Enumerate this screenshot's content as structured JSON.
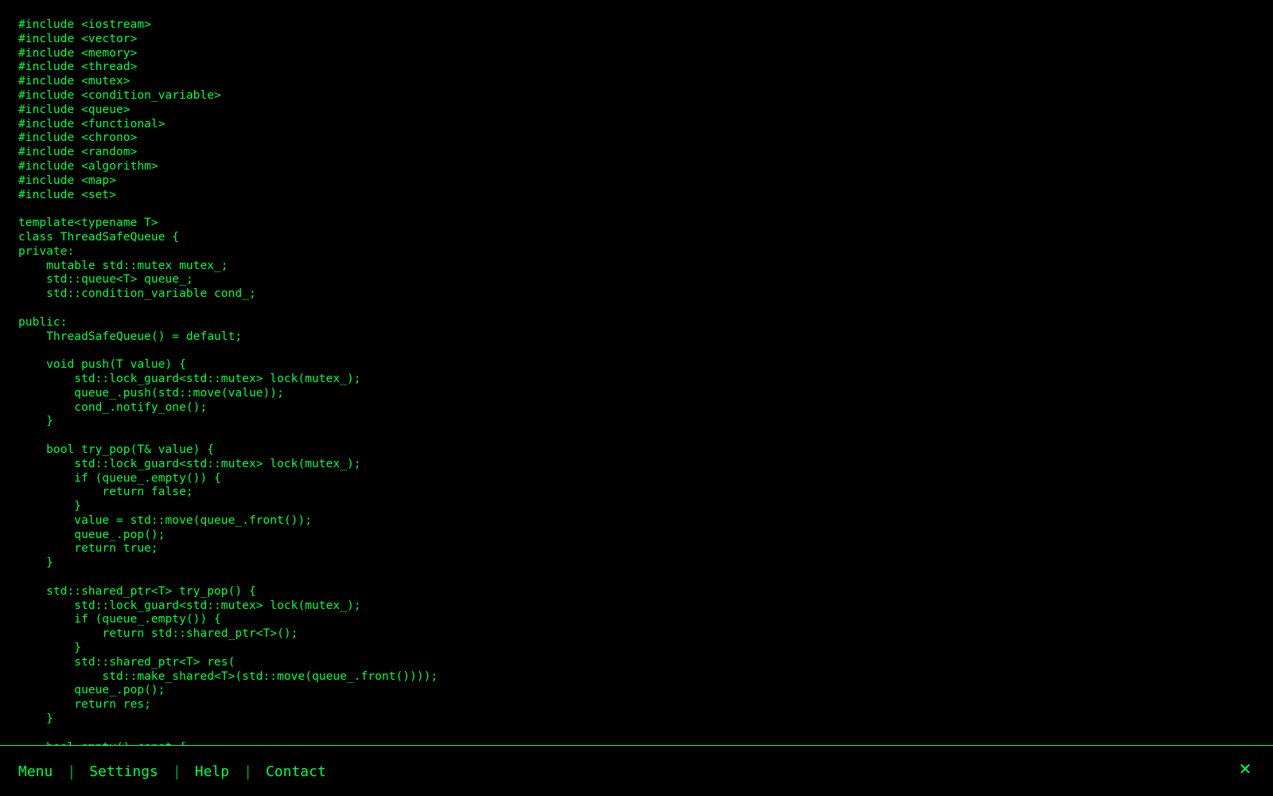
{
  "editor": {
    "code": "#include <iostream>\n#include <vector>\n#include <memory>\n#include <thread>\n#include <mutex>\n#include <condition_variable>\n#include <queue>\n#include <functional>\n#include <chrono>\n#include <random>\n#include <algorithm>\n#include <map>\n#include <set>\n\ntemplate<typename T>\nclass ThreadSafeQueue {\nprivate:\n    mutable std::mutex mutex_;\n    std::queue<T> queue_;\n    std::condition_variable cond_;\n\npublic:\n    ThreadSafeQueue() = default;\n\n    void push(T value) {\n        std::lock_guard<std::mutex> lock(mutex_);\n        queue_.push(std::move(value));\n        cond_.notify_one();\n    }\n\n    bool try_pop(T& value) {\n        std::lock_guard<std::mutex> lock(mutex_);\n        if (queue_.empty()) {\n            return false;\n        }\n        value = std::move(queue_.front());\n        queue_.pop();\n        return true;\n    }\n\n    std::shared_ptr<T> try_pop() {\n        std::lock_guard<std::mutex> lock(mutex_);\n        if (queue_.empty()) {\n            return std::shared_ptr<T>();\n        }\n        std::shared_ptr<T> res(\n            std::make_shared<T>(std::move(queue_.front())));\n        queue_.pop();\n        return res;\n    }\n\n    bool empty() const {"
  },
  "footer": {
    "links": [
      {
        "label": "Menu"
      },
      {
        "label": "Settings"
      },
      {
        "label": "Help"
      },
      {
        "label": "Contact"
      }
    ],
    "separator": "|",
    "close_glyph": "✕",
    "close_icon": "close-icon"
  },
  "colors": {
    "background": "#000000",
    "text": "#00ff41",
    "border": "#00ff41"
  }
}
